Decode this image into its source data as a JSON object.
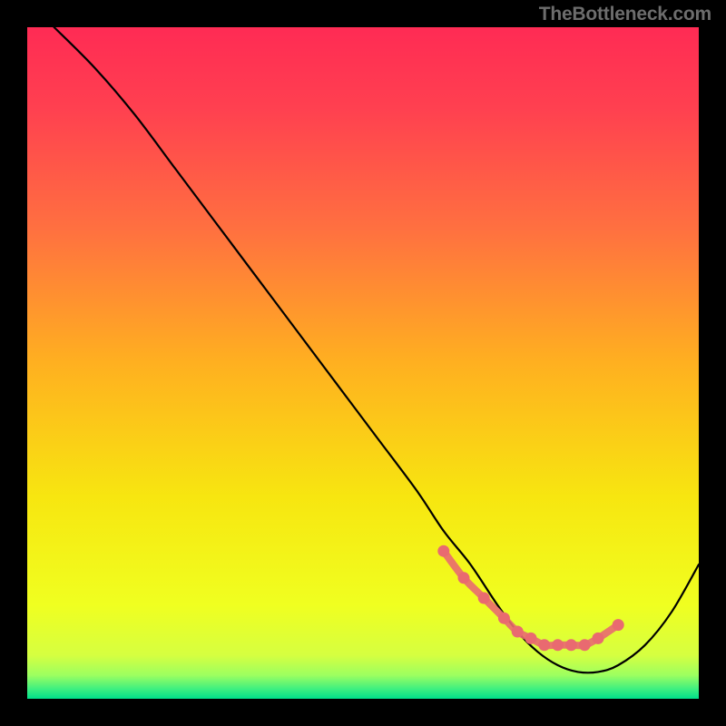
{
  "watermark": "TheBottleneck.com",
  "colors": {
    "frame": "#000000",
    "curve": "#000000",
    "markers": "#e96a70",
    "gradient_stops": [
      {
        "offset": 0.0,
        "color": "#ff2b54"
      },
      {
        "offset": 0.12,
        "color": "#ff4050"
      },
      {
        "offset": 0.3,
        "color": "#ff7040"
      },
      {
        "offset": 0.5,
        "color": "#ffb020"
      },
      {
        "offset": 0.7,
        "color": "#f7e610"
      },
      {
        "offset": 0.86,
        "color": "#f0ff20"
      },
      {
        "offset": 0.935,
        "color": "#d6ff40"
      },
      {
        "offset": 0.965,
        "color": "#9cff60"
      },
      {
        "offset": 0.985,
        "color": "#40f080"
      },
      {
        "offset": 1.0,
        "color": "#00e08a"
      }
    ]
  },
  "chart_data": {
    "type": "line",
    "title": "",
    "xlabel": "",
    "ylabel": "",
    "xlim": [
      0,
      100
    ],
    "ylim": [
      0,
      100
    ],
    "series": [
      {
        "name": "bottleneck-curve",
        "x": [
          4,
          10,
          16,
          22,
          28,
          34,
          40,
          46,
          52,
          58,
          62,
          66,
          70,
          73,
          76,
          79,
          82,
          85,
          88,
          92,
          96,
          100
        ],
        "values": [
          100,
          94,
          87,
          79,
          71,
          63,
          55,
          47,
          39,
          31,
          25,
          20,
          14,
          10,
          7,
          5,
          4,
          4,
          5,
          8,
          13,
          20
        ]
      }
    ],
    "markers": {
      "name": "highlight-dots",
      "x": [
        62,
        65,
        68,
        71,
        73,
        75,
        77,
        79,
        81,
        83,
        85,
        88
      ],
      "values": [
        22,
        18,
        15,
        12,
        10,
        9,
        8,
        8,
        8,
        8,
        9,
        11
      ]
    }
  }
}
